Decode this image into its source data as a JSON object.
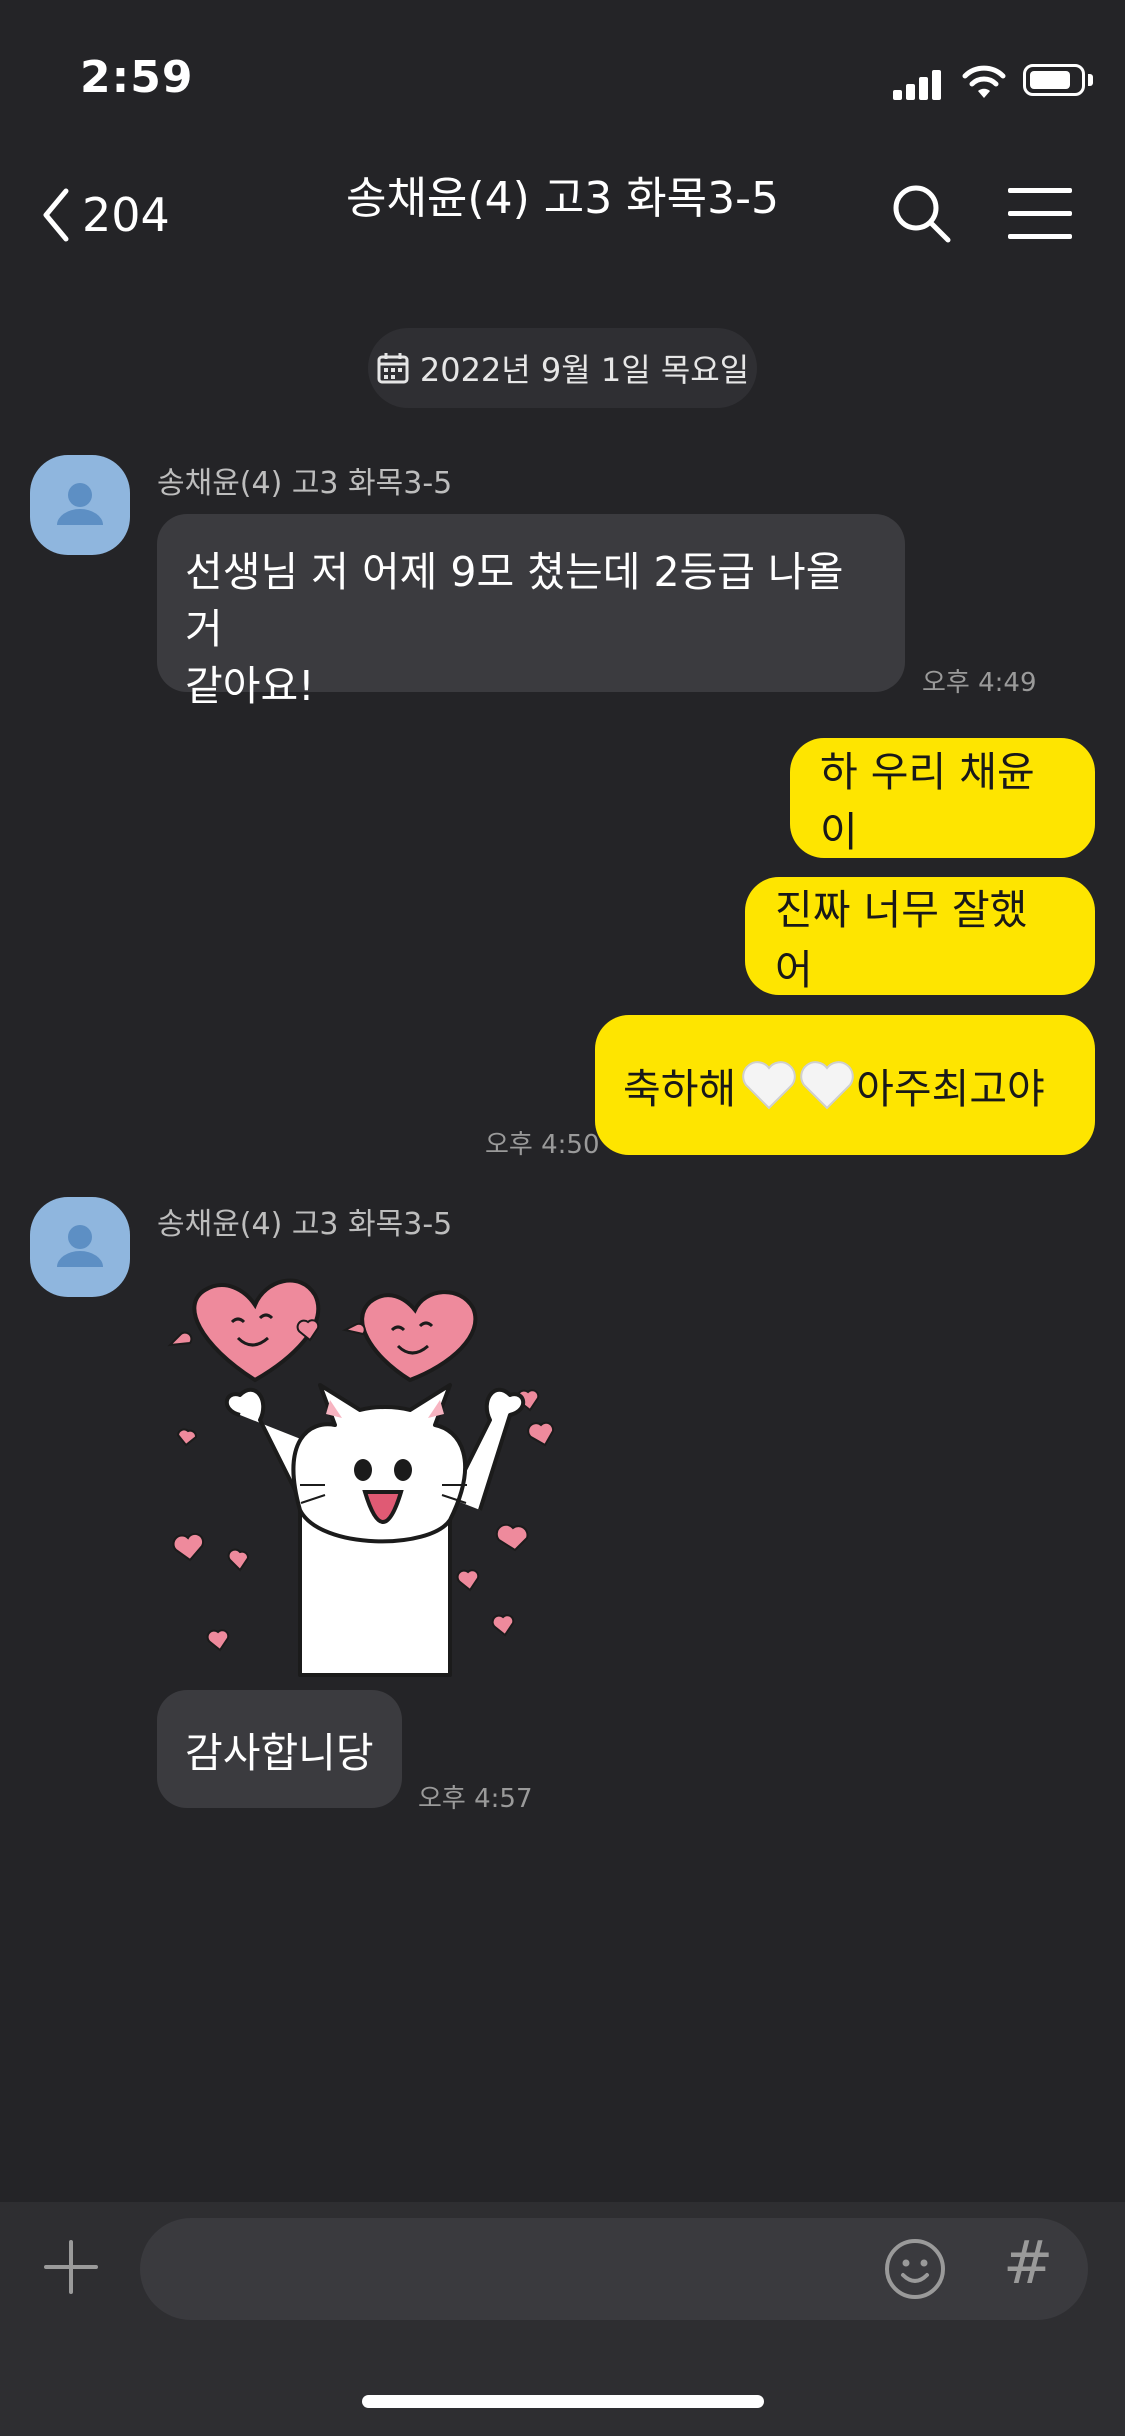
{
  "status": {
    "time": "2:59",
    "battery_level": 0.75
  },
  "header": {
    "back_count": "204",
    "title": "송채윤(4) 고3 화목3-5"
  },
  "date_divider": {
    "label": "2022년 9월 1일 목요일"
  },
  "messages": {
    "m1": {
      "sender": "송채윤(4) 고3 화목3-5",
      "line1": "선생님 저 어제 9모 쳤는데 2등급 나올 거",
      "line2": "같아요!",
      "time": "오후 4:49"
    },
    "m2": {
      "text": "하 우리 채윤이"
    },
    "m3": {
      "text": "진짜 너무 잘했어"
    },
    "m4": {
      "text_before": "축하해",
      "text_after": " 아주최고야",
      "time": "오후 4:50"
    },
    "m5": {
      "sender": "송채윤(4) 고3 화목3-5",
      "sticker": "cat-hearts-sticker"
    },
    "m6": {
      "text": "감사합니당",
      "time": "오후 4:57"
    }
  },
  "input": {
    "hash_label": "#"
  },
  "colors": {
    "background": "#242427",
    "outgoing_bubble": "#fee500",
    "incoming_bubble": "#3b3b3f",
    "avatar": "#8fb6de"
  },
  "icons": [
    "back-chevron-icon",
    "search-icon",
    "menu-icon",
    "calendar-icon",
    "avatar-person-icon",
    "white-heart-icon",
    "plus-icon",
    "emoji-icon"
  ]
}
